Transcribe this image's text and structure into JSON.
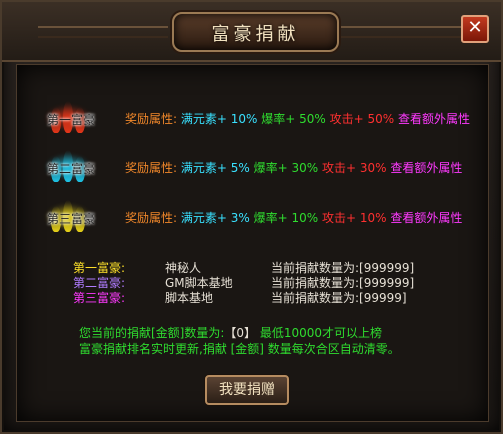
{
  "window": {
    "title": "富豪捐献",
    "close_label": "✕"
  },
  "tiers": [
    {
      "label": "第一富豪",
      "flame_color": "#ff3a1a",
      "attr_label": "奖励属性:",
      "e1": "满元素+ 10%",
      "e2": "爆率+ 50%",
      "e3": "攻击+ 50%",
      "link": "查看额外属性"
    },
    {
      "label": "第二富豪",
      "flame_color": "#1fd8ff",
      "attr_label": "奖励属性:",
      "e1": "满元素+  5%",
      "e2": "爆率+ 30%",
      "e3": "攻击+ 30%",
      "link": "查看额外属性"
    },
    {
      "label": "第三富豪",
      "flame_color": "#ffe81a",
      "attr_label": "奖励属性:",
      "e1": "满元素+  3%",
      "e2": "爆率+ 10%",
      "e3": "攻击+ 10%",
      "link": "查看额外属性"
    }
  ],
  "donors": [
    {
      "rank": "第一富豪:",
      "name": "神秘人",
      "count": "当前捐献数量为:[999999]",
      "color": "#ffe22a"
    },
    {
      "rank": "第二富豪:",
      "name": "GM脚本基地",
      "count": "当前捐献数量为:[999999]",
      "color": "#b07cff"
    },
    {
      "rank": "第三富豪:",
      "name": "脚本基地",
      "count": "当前捐献数量为:[99999]",
      "color": "#ff39ff"
    }
  ],
  "notes": {
    "line1_prefix": "您当前的捐献[金额]数量为:",
    "line1_value": "【0】",
    "line1_suffix": "  最低10000才可以上榜",
    "line2": "富豪捐献排名实时更新,捐献 [金额] 数量每次合区自动清零。"
  },
  "donate_button": "我要捐赠"
}
